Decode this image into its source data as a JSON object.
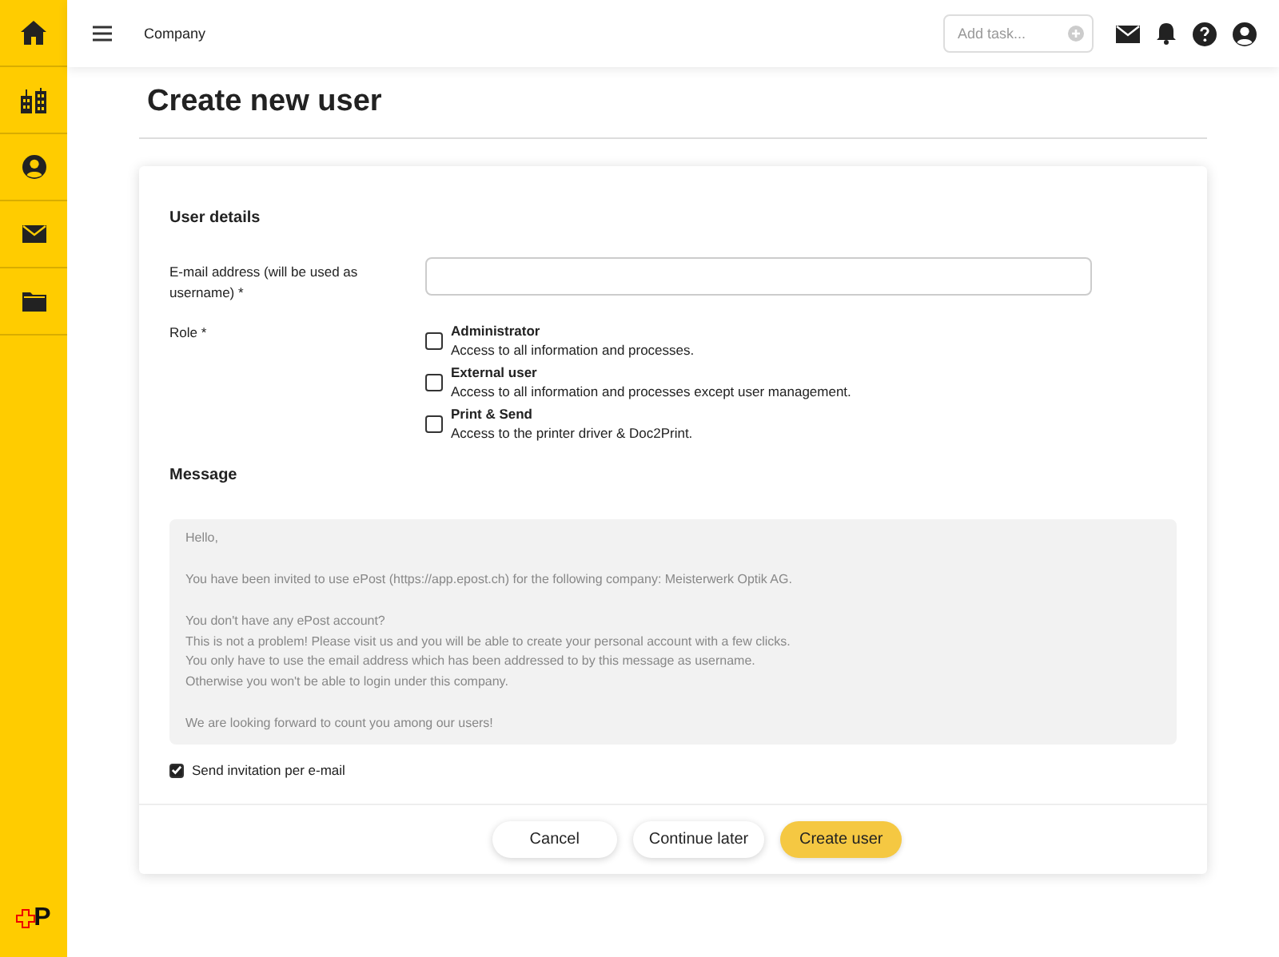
{
  "sidebar": {
    "items": [
      {
        "kind": "home"
      },
      {
        "kind": "buildings"
      },
      {
        "kind": "user"
      },
      {
        "kind": "mail"
      },
      {
        "kind": "folder"
      }
    ],
    "logo_text": "P"
  },
  "header": {
    "breadcrumb": "Company",
    "task_field": {
      "placeholder": "Add task..."
    }
  },
  "page_title": "Create new user",
  "form": {
    "section_title": "User details",
    "email": {
      "label": "E-mail address (will be used as username) *"
    },
    "role": {
      "label": "Role *",
      "options": [
        {
          "title": "Administrator",
          "description": "Access to all information and processes.",
          "checked": false
        },
        {
          "title": "External user",
          "description": "Access to all information and processes except user management.",
          "checked": false
        },
        {
          "title": "Print & Send",
          "description": "Access to the printer driver & Doc2Print.",
          "checked": false
        }
      ]
    },
    "message_title": "Message",
    "message": "Hello,\n\nYou have been invited to use ePost (https://app.epost.ch) for the following company: Meisterwerk Optik AG.\n\nYou don't have any ePost account?\nThis is not a problem! Please visit us and you will be able to create your personal account with a few clicks.\nYou only have to use the email address which has been addressed to by this message as username.\nOtherwise you won't be able to login under this company.\n\nWe are looking forward to count you among our users!",
    "send_invitation": {
      "label": "Send invitation per e-mail",
      "checked": true
    }
  },
  "buttons": [
    {
      "label": "Cancel",
      "kind": "secondary"
    },
    {
      "label": "Continue later",
      "kind": "secondary"
    },
    {
      "label": "Create user",
      "kind": "primary"
    }
  ]
}
